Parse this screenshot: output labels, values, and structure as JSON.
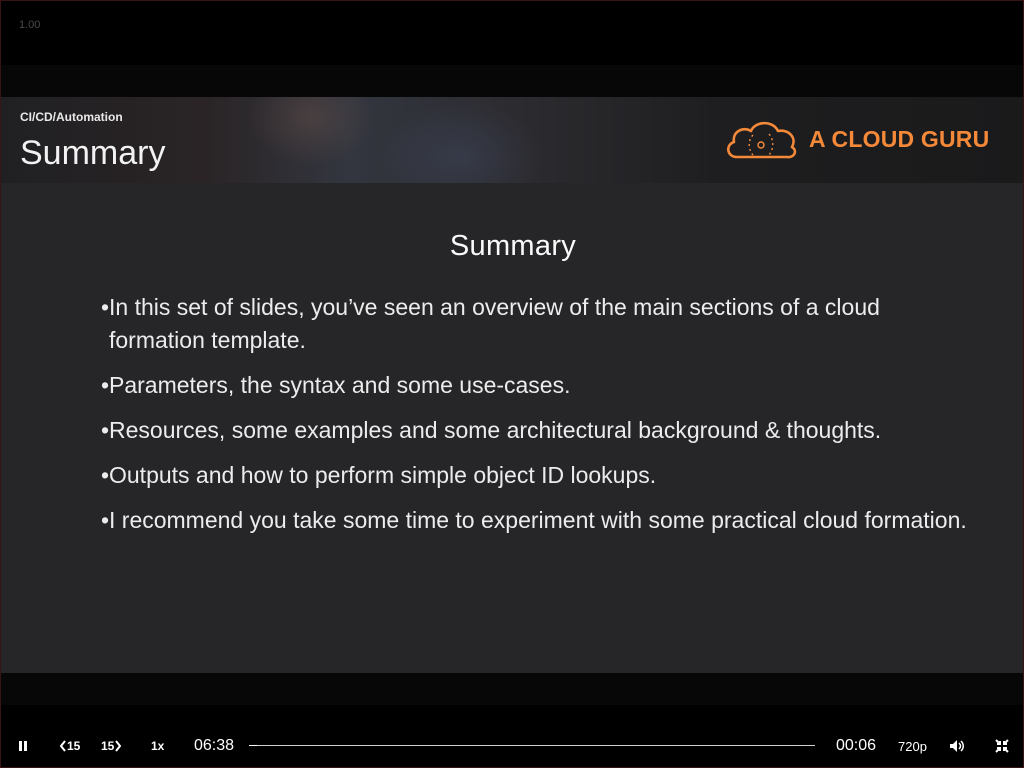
{
  "player": {
    "version": "1.00",
    "progress_fraction": 0.015
  },
  "slide": {
    "breadcrumb": "CI/CD/Automation",
    "header_title": "Summary",
    "logo_text": "A CLOUD GURU",
    "title": "Summary",
    "bullets": [
      "In this set of slides, you’ve seen an overview of the main sections of a cloud formation template.",
      "Parameters, the syntax and some use-cases.",
      "Resources, some examples and some architectural background & thoughts.",
      "Outputs and how to perform simple object ID lookups.",
      "I recommend you take some time to experiment with some practical cloud formation."
    ]
  },
  "controls": {
    "rewind_label": "15",
    "forward_label": "15",
    "speed_label": "1x",
    "time_remaining": "06:38",
    "time_elapsed": "00:06",
    "quality_label": "720p"
  },
  "colors": {
    "brand": "#f5893a",
    "slide_bg": "#262528"
  }
}
